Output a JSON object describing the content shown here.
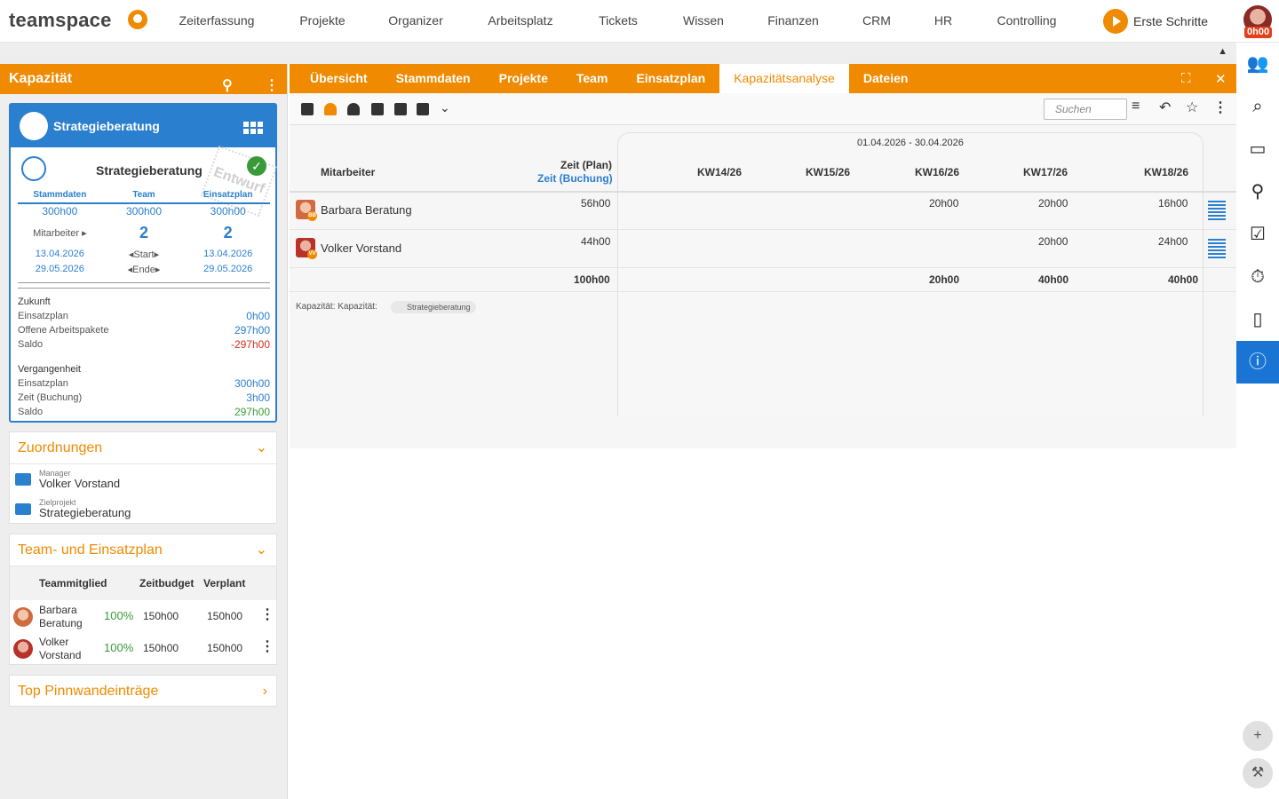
{
  "brand": {
    "name": "teamspace"
  },
  "nav": {
    "items": [
      "Zeiterfassung",
      "Projekte",
      "Organizer",
      "Arbeitsplatz",
      "Tickets",
      "Wissen",
      "Finanzen",
      "CRM",
      "HR",
      "Controlling"
    ],
    "erste": "Erste Schritte",
    "badge": "0h00"
  },
  "left": {
    "title": "Kapazität",
    "card": {
      "head": "Strategieberatung",
      "title": "Strategieberatung",
      "stamp": "Entwurf",
      "cols": [
        "Stammdaten",
        "Team",
        "Einsatzplan"
      ],
      "hours": [
        "300h00",
        "300h00",
        "300h00"
      ],
      "mitarbeiter_label": "Mitarbeiter ▸",
      "mitarbeiter": [
        "2",
        "2"
      ],
      "start_label": "◂Start▸",
      "end_label": "◂Ende▸",
      "start": [
        "13.04.2026",
        "13.04.2026"
      ],
      "end": [
        "29.05.2026",
        "29.05.2026"
      ],
      "zukunft": "Zukunft",
      "z_rows": [
        [
          "Einsatzplan",
          "0h00"
        ],
        [
          "Offene Arbeitspakete",
          "297h00"
        ],
        [
          "Saldo",
          "-297h00"
        ]
      ],
      "vergangenheit": "Vergangenheit",
      "v_rows": [
        [
          "Einsatzplan",
          "300h00"
        ],
        [
          "Zeit (Buchung)",
          "3h00"
        ],
        [
          "Saldo",
          "297h00"
        ]
      ]
    },
    "zuordnungen": {
      "title": "Zuordnungen",
      "manager_label": "Manager",
      "manager": "Volker Vorstand",
      "ziel_label": "Zielprojekt",
      "ziel": "Strategieberatung"
    },
    "team": {
      "title": "Team- und Einsatzplan",
      "headers": [
        "Teammitglied",
        "Zeitbudget",
        "Verplant"
      ],
      "rows": [
        {
          "name1": "Barbara",
          "name2": "Beratung",
          "pct": "100%",
          "budget": "150h00",
          "plan": "150h00"
        },
        {
          "name1": "Volker",
          "name2": "Vorstand",
          "pct": "100%",
          "budget": "150h00",
          "plan": "150h00"
        }
      ]
    },
    "pinn": {
      "title": "Top Pinnwandeinträge"
    }
  },
  "tabs": [
    "Übersicht",
    "Stammdaten",
    "Projekte",
    "Team",
    "Einsatzplan",
    "Kapazitätsanalyse",
    "Dateien"
  ],
  "search": {
    "placeholder": "Suchen"
  },
  "grid": {
    "range": "01.04.2026 - 30.04.2026",
    "col_mitarbeiter": "Mitarbeiter",
    "col_plan": "Zeit (Plan)",
    "col_buchung": "Zeit (Buchung)",
    "weeks": [
      "KW14/26",
      "KW15/26",
      "KW16/26",
      "KW17/26",
      "KW18/26"
    ],
    "rows": [
      {
        "name": "Barbara Beratung",
        "initials": "BB",
        "total": "56h00",
        "weeks": [
          "",
          "",
          "20h00",
          "20h00",
          "16h00"
        ]
      },
      {
        "name": "Volker Vorstand",
        "initials": "VV",
        "total": "44h00",
        "weeks": [
          "",
          "",
          "",
          "20h00",
          "24h00"
        ]
      }
    ],
    "sum": {
      "total": "100h00",
      "weeks": [
        "",
        "",
        "20h00",
        "40h00",
        "40h00"
      ]
    },
    "footer_label": "Kapazität: Kapazität:",
    "footer_tag": "Strategieberatung"
  }
}
